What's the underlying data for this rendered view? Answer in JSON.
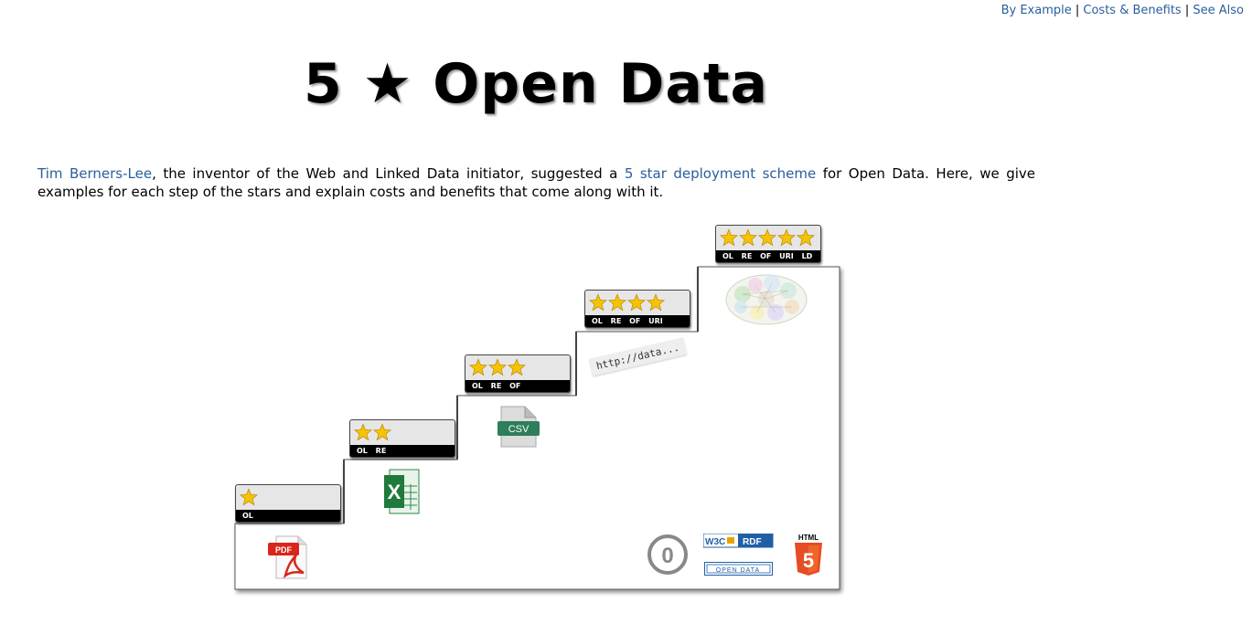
{
  "nav": {
    "items": [
      "By Example",
      "Costs & Benefits",
      "See Also"
    ],
    "separator": "|"
  },
  "title": "5 ★ Open Data",
  "intro": {
    "link1": "Tim Berners-Lee",
    "text1": ", the inventor of the Web and Linked Data initiator, suggested a ",
    "link2": "5 star deployment scheme",
    "text2": " for Open Data. Here, we give examples for each step of the stars and explain costs and benefits that come along with it."
  },
  "steps": [
    {
      "stars": 1,
      "labels": "OL",
      "icon": "pdf-file-icon",
      "icon_text": "PDF"
    },
    {
      "stars": 2,
      "labels": "OL RE",
      "icon": "excel-file-icon",
      "icon_text": "X"
    },
    {
      "stars": 3,
      "labels": "OL RE OF",
      "icon": "csv-file-icon",
      "icon_text": "CSV"
    },
    {
      "stars": 4,
      "labels": "OL RE OF URI",
      "icon": "uri-snippet",
      "icon_text": "http://data..."
    },
    {
      "stars": 5,
      "labels": "OL RE OF URI LD",
      "icon": "linked-data-cloud-icon",
      "icon_text": ""
    }
  ],
  "footer_logos": {
    "zero": "0",
    "w3c": "W3C",
    "rdf": "RDF",
    "opendata": "OPEN DATA",
    "html": "HTML",
    "html5": "5"
  },
  "colors": {
    "link": "#2a5e9c",
    "star": "#f5c400",
    "rdf_blue": "#1f5fa6",
    "html5_orange": "#e44d26",
    "excel_green": "#1f7a3c",
    "csv_green": "#2e7d5b",
    "pdf_red": "#d9261c"
  }
}
